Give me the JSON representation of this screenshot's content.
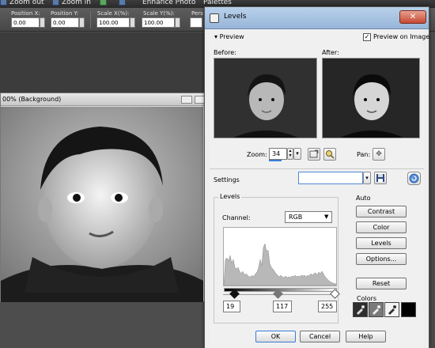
{
  "host": {
    "menu": {
      "zoom_out": "Zoom out",
      "zoom_in": "Zoom in",
      "enhance_photo": "Enhance Photo",
      "palettes": "Palettes"
    },
    "toolbar": {
      "position_x_label": "Position X:",
      "position_x_value": "0.00",
      "position_y_label": "Position Y:",
      "position_y_value": "0.00",
      "scale_x_label": "Scale X(%):",
      "scale_x_value": "100.00",
      "scale_y_label": "Scale Y(%):",
      "scale_y_value": "100.00",
      "pers_label": "Pers"
    },
    "image_window": {
      "title": "00% (Background)"
    }
  },
  "dialog": {
    "title": "Levels",
    "close_glyph": "✕",
    "preview": {
      "label": "Preview",
      "preview_on_image_label": "Preview on Image",
      "preview_on_image_checked": true,
      "before_label": "Before:",
      "after_label": "After:",
      "zoom_label": "Zoom:",
      "zoom_value": "34",
      "pan_label": "Pan:"
    },
    "settings": {
      "label": "Settings",
      "value": ""
    },
    "levels": {
      "group_label": "Levels",
      "channel_label": "Channel:",
      "channel_value": "RGB",
      "input_black": "19",
      "input_mid": "117",
      "input_white": "255"
    },
    "auto": {
      "group_label": "Auto",
      "contrast_button": "Contrast",
      "color_button": "Color",
      "levels_button": "Levels",
      "options_button": "Options...",
      "reset_button": "Reset"
    },
    "colors": {
      "label": "Colors",
      "swatch_color": "#000000"
    },
    "buttons": {
      "ok": "OK",
      "cancel": "Cancel",
      "help": "Help"
    }
  },
  "icons": {
    "dropdown": "chevron-down-icon",
    "save": "save-icon",
    "reset_preset": "reset-preset-icon",
    "pan": "move-icon",
    "eyedropper": "eyedropper-icon"
  }
}
